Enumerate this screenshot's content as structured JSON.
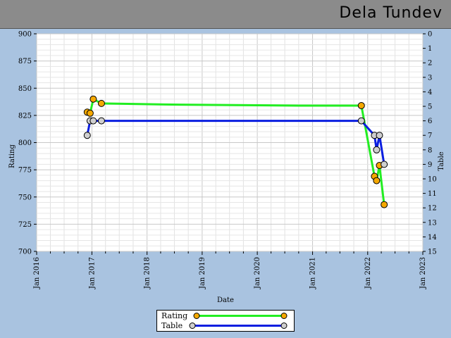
{
  "header": {
    "title": "Dela Tundev"
  },
  "chart_data": {
    "type": "line",
    "xlabel": "Date",
    "ylabel": "Rating",
    "y2label": "Table",
    "xlim": [
      "2016-01-01",
      "2023-01-01"
    ],
    "xticks": [
      "Jan 2016",
      "Jan 2017",
      "Jan 2018",
      "Jan 2019",
      "Jan 2020",
      "Jan 2021",
      "Jan 2022",
      "Jan 2023"
    ],
    "ylim": [
      700,
      900
    ],
    "yticks": [
      700,
      725,
      750,
      775,
      800,
      825,
      850,
      875,
      900
    ],
    "y2lim": [
      15,
      0
    ],
    "y2ticks": [
      0,
      1,
      2,
      3,
      4,
      5,
      6,
      7,
      8,
      9,
      10,
      11,
      12,
      13,
      14,
      15
    ],
    "grid": true,
    "legend_position": "bottom",
    "series": [
      {
        "name": "Rating",
        "axis": "left",
        "line_color": "#22ee22",
        "marker_color": "#f5a800",
        "points": [
          {
            "x": "2016-12-01",
            "y": 828,
            "marker": true
          },
          {
            "x": "2016-12-20",
            "y": 827,
            "marker": true
          },
          {
            "x": "2017-01-10",
            "y": 840,
            "marker": true
          },
          {
            "x": "2017-03-05",
            "y": 836,
            "marker": true
          },
          {
            "x": "2017-03-05",
            "y": 836,
            "marker": false
          },
          {
            "x": "2018-05-01",
            "y": 835,
            "marker": false
          },
          {
            "x": "2020-10-01",
            "y": 834,
            "marker": false
          },
          {
            "x": "2021-11-20",
            "y": 834,
            "marker": true
          },
          {
            "x": "2022-02-15",
            "y": 769,
            "marker": true
          },
          {
            "x": "2022-03-01",
            "y": 765,
            "marker": true
          },
          {
            "x": "2022-03-20",
            "y": 779,
            "marker": true
          },
          {
            "x": "2022-04-20",
            "y": 743,
            "marker": true
          }
        ]
      },
      {
        "name": "Table",
        "axis": "right",
        "line_color": "#0a1ee0",
        "marker_color": "#cfcfcf",
        "points": [
          {
            "x": "2016-12-01",
            "y": 7,
            "marker": true
          },
          {
            "x": "2016-12-20",
            "y": 6,
            "marker": true
          },
          {
            "x": "2017-01-10",
            "y": 6,
            "marker": true
          },
          {
            "x": "2017-03-05",
            "y": 6,
            "marker": true
          },
          {
            "x": "2021-11-20",
            "y": 6,
            "marker": true
          },
          {
            "x": "2022-02-15",
            "y": 7,
            "marker": true
          },
          {
            "x": "2022-03-01",
            "y": 8,
            "marker": true
          },
          {
            "x": "2022-03-20",
            "y": 7,
            "marker": true
          },
          {
            "x": "2022-04-20",
            "y": 9,
            "marker": true
          }
        ]
      }
    ]
  }
}
